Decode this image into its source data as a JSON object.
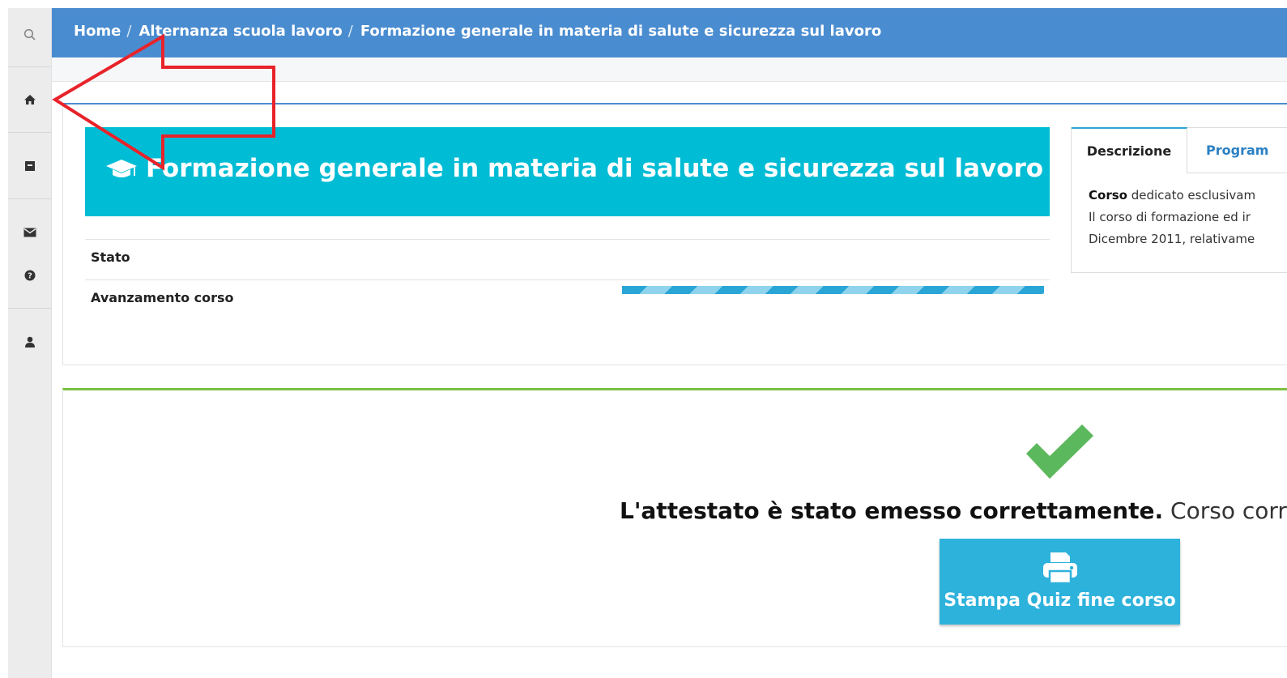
{
  "sidebar": {
    "items": [
      {
        "icon": "search-icon"
      },
      {
        "icon": "home-icon"
      },
      {
        "icon": "archive-icon"
      },
      {
        "icon": "envelope-icon"
      },
      {
        "icon": "question-circle-icon"
      },
      {
        "icon": "user-icon"
      }
    ]
  },
  "breadcrumb": {
    "home": "Home",
    "section": "Alternanza scuola lavoro",
    "current": "Formazione generale in materia di salute e sicurezza sul lavoro",
    "separator": "/"
  },
  "course": {
    "title": "Formazione generale in materia di salute e sicurezza sul lavoro",
    "icon": "graduation-cap-icon",
    "status_label": "Stato",
    "progress_label": "Avanzamento corso",
    "progress": 1.0
  },
  "tabs": {
    "active": "Descrizione",
    "other": "Program",
    "description_lines": [
      {
        "bold": "Corso",
        "text": " dedicato esclusivam"
      },
      {
        "bold": "",
        "text": "Il corso di formazione ed ir"
      },
      {
        "bold": "",
        "text": "Dicembre 2011, relativame"
      }
    ]
  },
  "completion": {
    "icon": "checkmark-icon",
    "message_bold": "L'attestato è stato emesso correttamente.",
    "message_rest": "Corso corret",
    "print_button_label": "Stampa Quiz fine corso",
    "print_icon": "printer-icon"
  },
  "colors": {
    "topbar": "#4a8cd0",
    "course_header": "#00bcd4",
    "success": "#5cb85c",
    "button": "#2db2dc",
    "annotation_arrow": "#e8232a"
  }
}
